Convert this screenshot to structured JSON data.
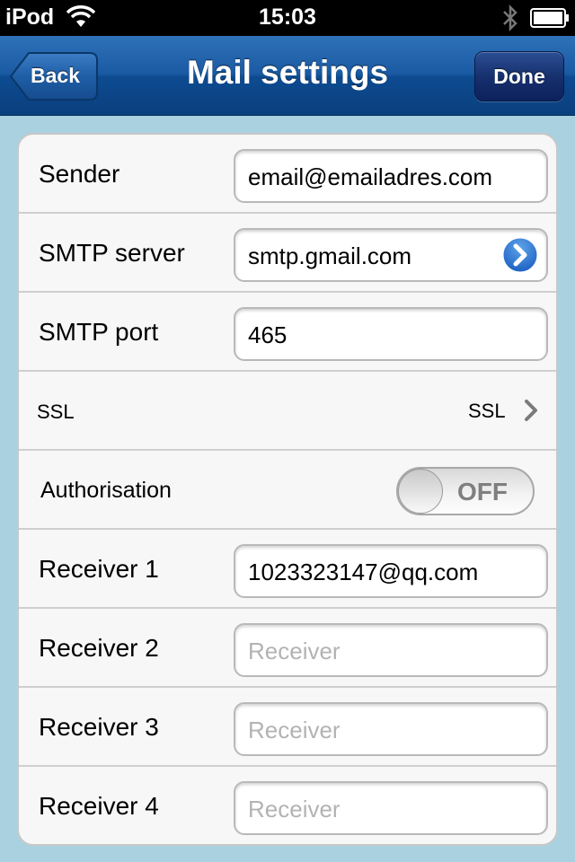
{
  "status_bar": {
    "carrier": "iPod",
    "time": "15:03"
  },
  "nav": {
    "title": "Mail settings",
    "back_label": "Back",
    "done_label": "Done"
  },
  "form": {
    "sender": {
      "label": "Sender",
      "value": "email@emailadres.com"
    },
    "smtp_server": {
      "label": "SMTP server",
      "value": "smtp.gmail.com"
    },
    "smtp_port": {
      "label": "SMTP port",
      "value": "465"
    },
    "ssl": {
      "label": "SSL",
      "value": "SSL"
    },
    "authorisation": {
      "label": "Authorisation",
      "toggle_label": "OFF",
      "on": false
    },
    "receivers": [
      {
        "label": "Receiver 1",
        "value": "1023323147@qq.com",
        "placeholder": "Receiver"
      },
      {
        "label": "Receiver 2",
        "value": "",
        "placeholder": "Receiver"
      },
      {
        "label": "Receiver 3",
        "value": "",
        "placeholder": "Receiver"
      },
      {
        "label": "Receiver 4",
        "value": "",
        "placeholder": "Receiver"
      }
    ]
  },
  "colors": {
    "nav_blue": "#1a5aa2",
    "done_button": "#17306e",
    "background": "#a9d1e0"
  }
}
